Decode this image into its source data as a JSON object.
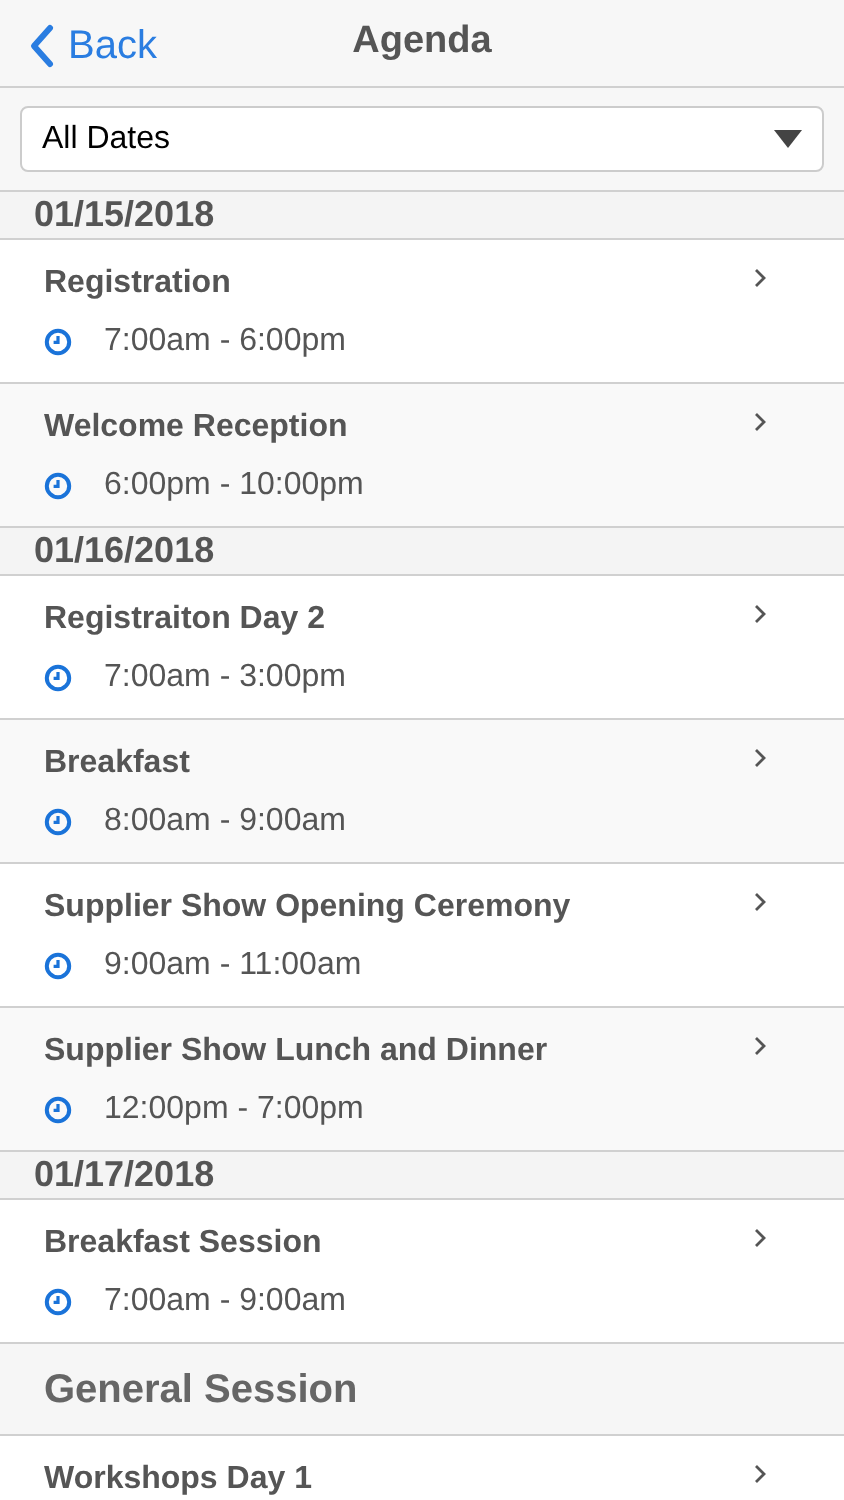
{
  "nav": {
    "back": "Back",
    "title": "Agenda"
  },
  "filter": {
    "value": "All Dates"
  },
  "sections": [
    {
      "date": "01/15/2018",
      "items": [
        {
          "kind": "event",
          "title": "Registration",
          "time": "7:00am - 6:00pm"
        },
        {
          "kind": "event",
          "title": "Welcome Reception",
          "time": "6:00pm - 10:00pm"
        }
      ]
    },
    {
      "date": "01/16/2018",
      "items": [
        {
          "kind": "event",
          "title": "Registraiton Day 2",
          "time": "7:00am - 3:00pm"
        },
        {
          "kind": "event",
          "title": "Breakfast",
          "time": "8:00am - 9:00am"
        },
        {
          "kind": "event",
          "title": "Supplier Show Opening Ceremony",
          "time": "9:00am - 11:00am"
        },
        {
          "kind": "event",
          "title": "Supplier Show Lunch and Dinner",
          "time": "12:00pm - 7:00pm"
        }
      ]
    },
    {
      "date": "01/17/2018",
      "items": [
        {
          "kind": "event",
          "title": "Breakfast Session",
          "time": "7:00am - 9:00am"
        },
        {
          "kind": "group",
          "title": "General Session"
        },
        {
          "kind": "event",
          "title": "Workshops Day 1"
        }
      ]
    }
  ]
}
